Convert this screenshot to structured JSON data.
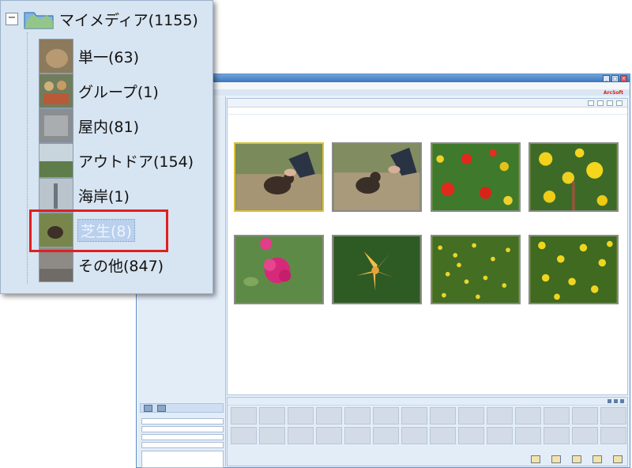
{
  "tree": {
    "root_label": "マイメディア(1155)",
    "expander": "−",
    "items": [
      {
        "label": "単一(63)"
      },
      {
        "label": "グループ(1)"
      },
      {
        "label": "屋内(81)"
      },
      {
        "label": "アウトドア(154)"
      },
      {
        "label": "海岸(1)"
      },
      {
        "label": "芝生(8)",
        "selected": true
      },
      {
        "label": "その他(847)"
      }
    ]
  },
  "app": {
    "brand": "ArcSoft",
    "highlight_color": "#e02020",
    "accent": "#5f8fc7"
  }
}
